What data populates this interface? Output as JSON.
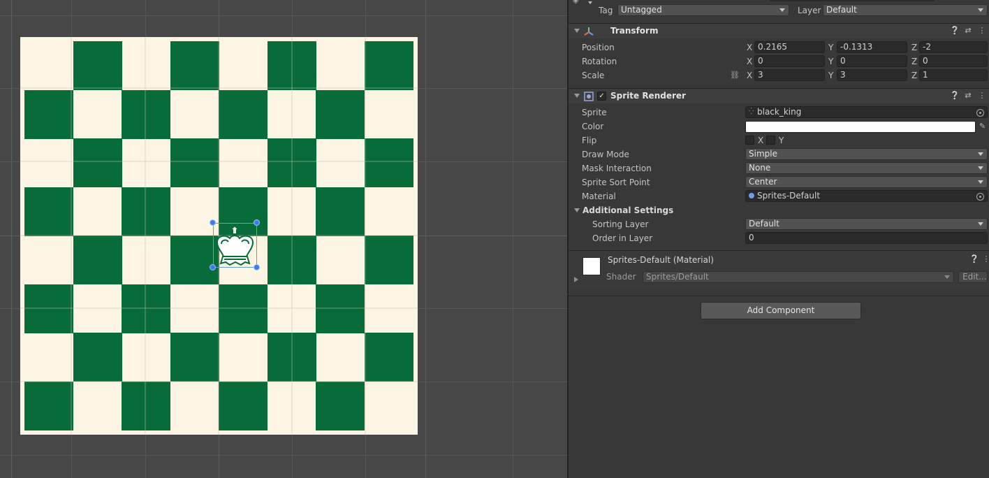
{
  "header": {
    "tag_label": "Tag",
    "tag_value": "Untagged",
    "layer_label": "Layer",
    "layer_value": "Default"
  },
  "transform": {
    "title": "Transform",
    "position": {
      "label": "Position",
      "x": "0.2165",
      "y": "-0.1313",
      "z": "-2"
    },
    "rotation": {
      "label": "Rotation",
      "x": "0",
      "y": "0",
      "z": "0"
    },
    "scale": {
      "label": "Scale",
      "x": "3",
      "y": "3",
      "z": "1"
    },
    "axes": {
      "x": "X",
      "y": "Y",
      "z": "Z"
    }
  },
  "sprite_renderer": {
    "title": "Sprite Renderer",
    "enabled": true,
    "sprite": {
      "label": "Sprite",
      "value": "black_king"
    },
    "color": {
      "label": "Color",
      "value": "#ffffff"
    },
    "flip": {
      "label": "Flip",
      "x": "X",
      "y": "Y"
    },
    "draw_mode": {
      "label": "Draw Mode",
      "value": "Simple"
    },
    "mask_interaction": {
      "label": "Mask Interaction",
      "value": "None"
    },
    "sprite_sort_point": {
      "label": "Sprite Sort Point",
      "value": "Center"
    },
    "material": {
      "label": "Material",
      "value": "Sprites-Default"
    },
    "additional": {
      "title": "Additional Settings",
      "sorting_layer": {
        "label": "Sorting Layer",
        "value": "Default"
      },
      "order_in_layer": {
        "label": "Order in Layer",
        "value": "0"
      }
    }
  },
  "material_block": {
    "title": "Sprites-Default (Material)",
    "shader_label": "Shader",
    "shader_value": "Sprites/Default",
    "edit_label": "Edit..."
  },
  "add_component": "Add Component",
  "colors": {
    "board_dark": "#086c3a",
    "board_light": "#fdf5e4",
    "selection": "#3f7de6"
  },
  "icons": {
    "transform": "transform-axes-icon",
    "sprite_renderer": "sprite-renderer-icon",
    "help": "help-icon",
    "presets": "presets-icon",
    "menu": "kebab-menu-icon"
  }
}
